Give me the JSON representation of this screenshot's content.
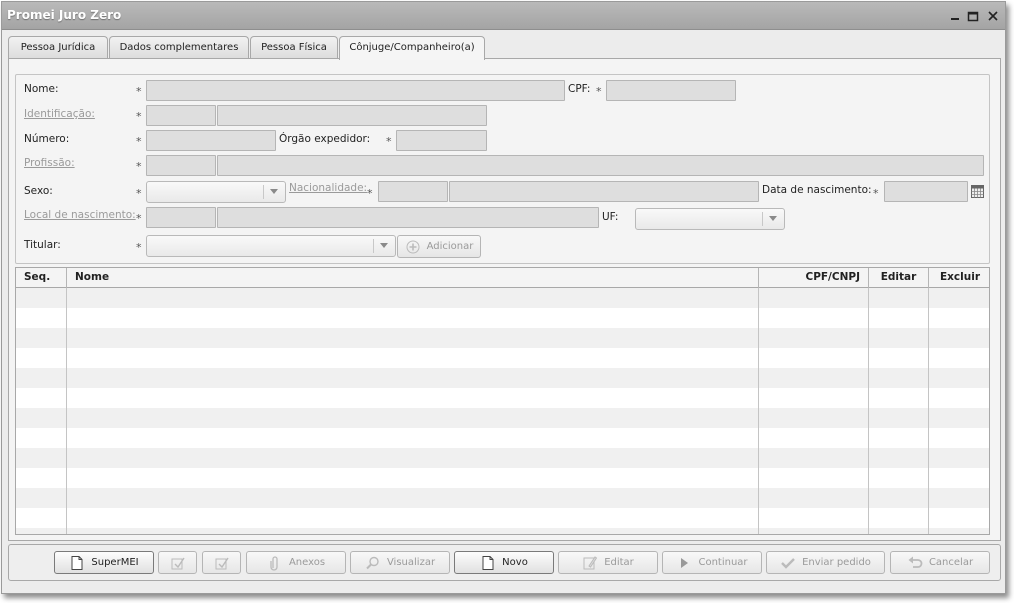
{
  "window": {
    "title": "Promei Juro Zero"
  },
  "tabs": [
    {
      "label": "Pessoa Jurídica"
    },
    {
      "label": "Dados complementares"
    },
    {
      "label": "Pessoa Física"
    },
    {
      "label": "Cônjuge/Companheiro(a)",
      "active": true
    }
  ],
  "form": {
    "required_mark": "*",
    "nome_label": "Nome:",
    "cpf_label": "CPF:",
    "identificacao_label": "Identificação:",
    "numero_label": "Número:",
    "orgao_label": "Órgão expedidor:",
    "profissao_label": "Profissão:",
    "sexo_label": "Sexo:",
    "nacionalidade_label": "Nacionalidade:",
    "data_nasc_label": "Data de nascimento:",
    "local_nasc_label": "Local de nascimento:",
    "uf_label": "UF:",
    "titular_label": "Titular:",
    "adicionar_label": "Adicionar"
  },
  "table": {
    "columns": [
      "Seq.",
      "Nome",
      "CPF/CNPJ",
      "Editar",
      "Excluir"
    ],
    "rows": []
  },
  "toolbar": {
    "supermei": "SuperMEI",
    "anexos": "Anexos",
    "visualizar": "Visualizar",
    "novo": "Novo",
    "editar": "Editar",
    "continuar": "Continuar",
    "enviar_pedido": "Enviar pedido",
    "cancelar": "Cancelar"
  }
}
